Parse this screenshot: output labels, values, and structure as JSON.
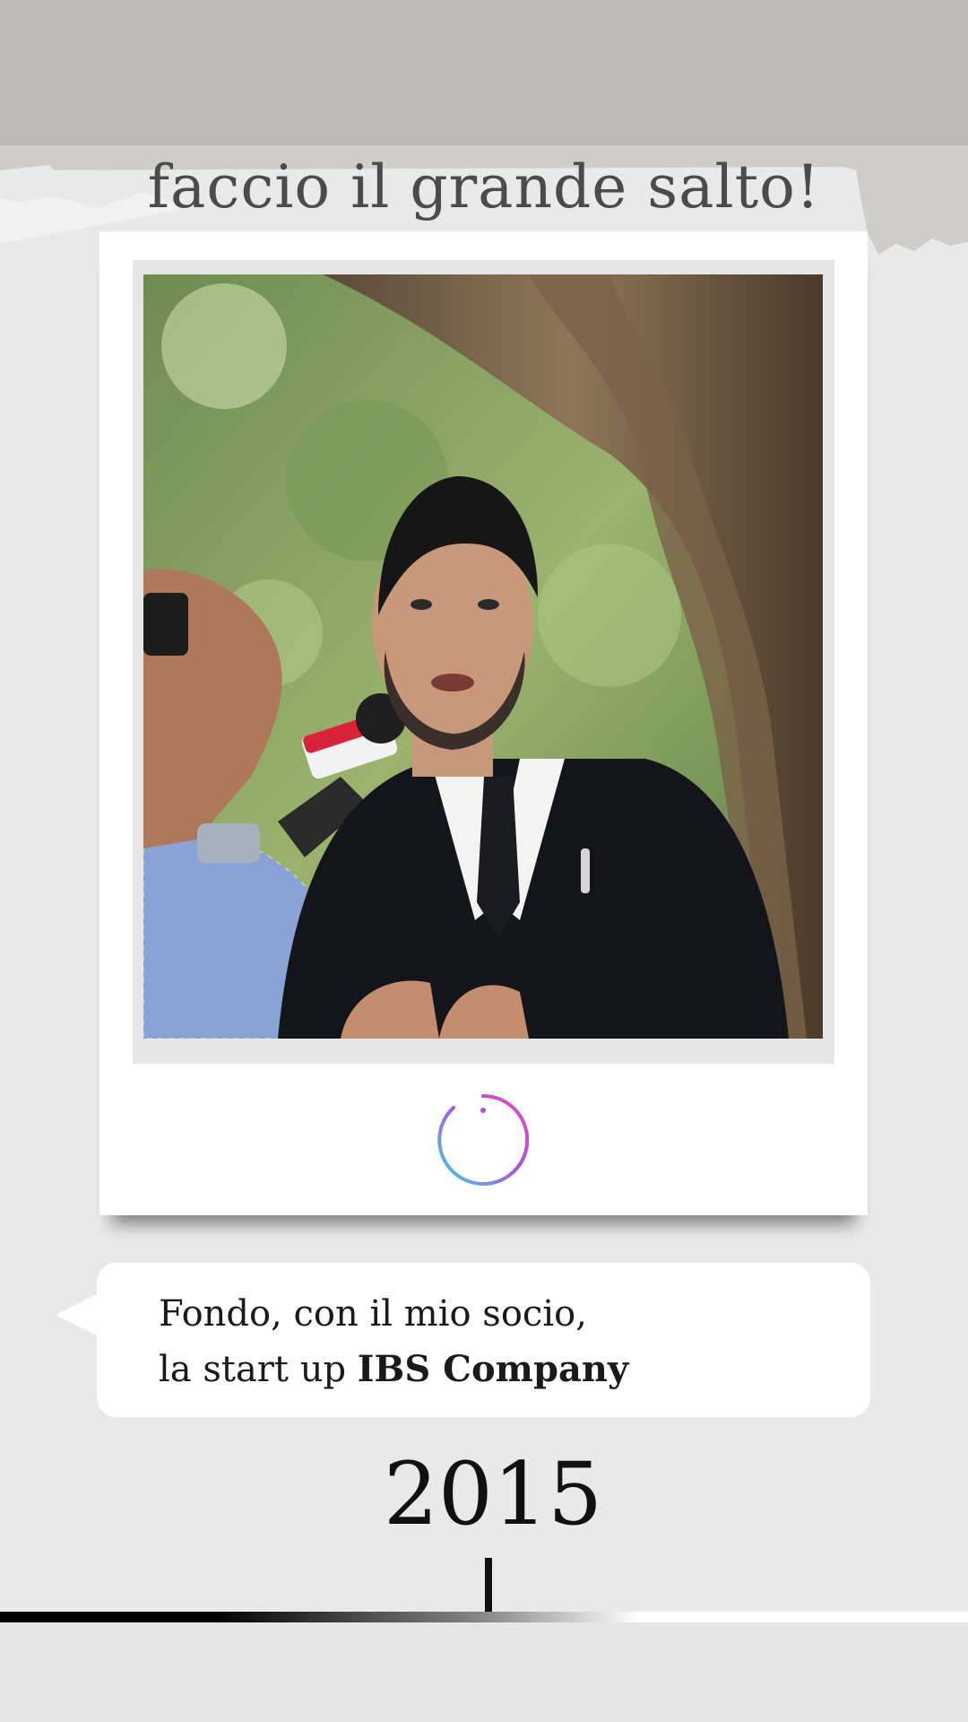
{
  "headline": "faccio il grande salto!",
  "photo": {
    "icon": "interview-photo",
    "description_icon": "man-in-suit-interview"
  },
  "logo": {
    "icon": "info-circle-logo"
  },
  "bubble": {
    "line1": "Fondo, con il mio socio,",
    "line2_prefix": "la start up ",
    "line2_bold": "IBS Company"
  },
  "year": "2015",
  "colors": {
    "background": "#e9e9e9",
    "top_band": "#bcb8b4",
    "headline": "#4b4b4b",
    "logo_gradient": [
      "#3fd4e6",
      "#b24de0",
      "#e24fb8"
    ]
  }
}
